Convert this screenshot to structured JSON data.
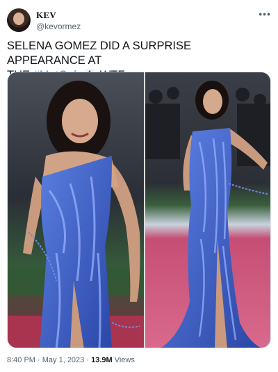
{
  "author": {
    "name": "KEV",
    "handle": "@kevormez",
    "more_icon": "more-horizontal-icon"
  },
  "tweet": {
    "text_line1": "SELENA GOMEZ DID A SURPRISE APPEARANCE AT",
    "text_prefix": "THE ",
    "hashtag": "#MetGala",
    "text_suffix": " WTF"
  },
  "media": {
    "count": 2,
    "left_photo_icon": "photo-gown-closeup",
    "right_photo_icon": "photo-gown-full"
  },
  "meta": {
    "time": "8:40 PM",
    "separator": " · ",
    "date": "May 1, 2023",
    "views_count": "13.9M",
    "views_label": " Views"
  },
  "colors": {
    "hashtag": "#1d9bf0",
    "secondary_text": "#536471",
    "dress_blue": "#3f5fc4"
  }
}
